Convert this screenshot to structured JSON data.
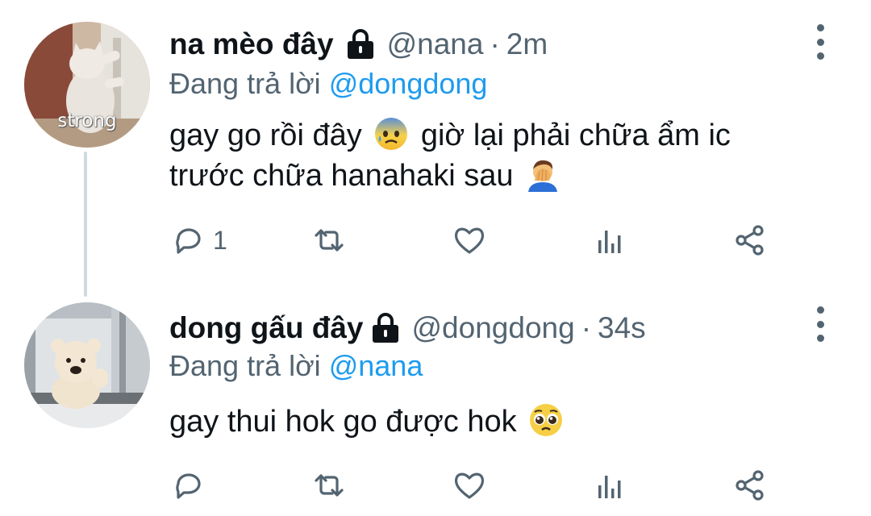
{
  "tweets": [
    {
      "display_name": "na mèo đây",
      "handle": "@nana",
      "separator": "·",
      "time": "2m",
      "reply_prefix": "Đang trả lời",
      "reply_to": "@dongdong",
      "avatar_caption": "strong",
      "text_line1": "gay go rồi đây",
      "text_line1b": "giờ lại phải chữa ẩm ic",
      "text_line2": "trước chữa hanahaki sau",
      "emojis": [
        "anxious-face-with-sweat-icon",
        "man-facepalming-icon"
      ],
      "reply_count": "1"
    },
    {
      "display_name": "dong gấu đây",
      "handle": "@dongdong",
      "separator": "·",
      "time": "34s",
      "reply_prefix": "Đang trả lời",
      "reply_to": "@nana",
      "text_line1": "gay thui hok go được hok",
      "emojis": [
        "pleading-face-icon"
      ]
    }
  ],
  "colors": {
    "primary_text": "#0f1419",
    "secondary_text": "#536471",
    "link": "#1d9bf0",
    "thread_line": "#cfd9de"
  }
}
